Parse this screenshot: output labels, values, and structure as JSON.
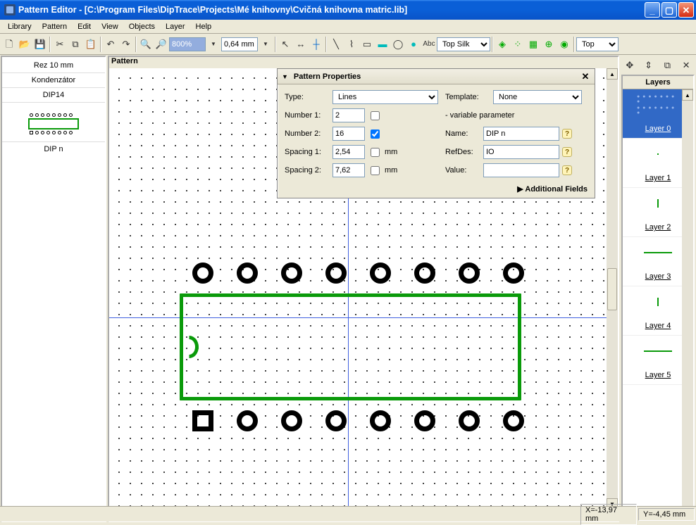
{
  "title": "Pattern Editor - [C:\\Program Files\\DipTrace\\Projects\\Mé knihovny\\Cvičná knihovna matric.lib]",
  "menu": [
    "Library",
    "Pattern",
    "Edit",
    "View",
    "Objects",
    "Layer",
    "Help"
  ],
  "toolbar": {
    "zoom_val": "800%",
    "grid_val": "0,64 mm",
    "layer_sel": "Top Silk",
    "side_sel": "Top"
  },
  "left": {
    "items": [
      "Rez 10 mm",
      "Kondenzátor",
      "DIP14",
      "",
      "DIP n"
    ]
  },
  "canvas": {
    "label": "Pattern"
  },
  "pp": {
    "title": "Pattern Properties",
    "type_label": "Type:",
    "type_val": "Lines",
    "template_label": "Template:",
    "template_val": "None",
    "number1_label": "Number 1:",
    "number1_val": "2",
    "var_label": "- variable parameter",
    "number2_label": "Number 2:",
    "number2_val": "16",
    "name_label": "Name:",
    "name_val": "DIP n",
    "spacing1_label": "Spacing 1:",
    "spacing1_val": "2,54",
    "mm": "mm",
    "refdes_label": "RefDes:",
    "refdes_val": "IO",
    "spacing2_label": "Spacing 2:",
    "spacing2_val": "7,62",
    "value_label": "Value:",
    "value_val": "",
    "additional": "Additional Fields"
  },
  "layers": {
    "title": "Layers",
    "items": [
      "Layer 0",
      "Layer 1",
      "Layer 2",
      "Layer 3",
      "Layer 4",
      "Layer 5"
    ]
  },
  "status": {
    "x": "X=-13,97 mm",
    "y": "Y=-4,45 mm"
  }
}
